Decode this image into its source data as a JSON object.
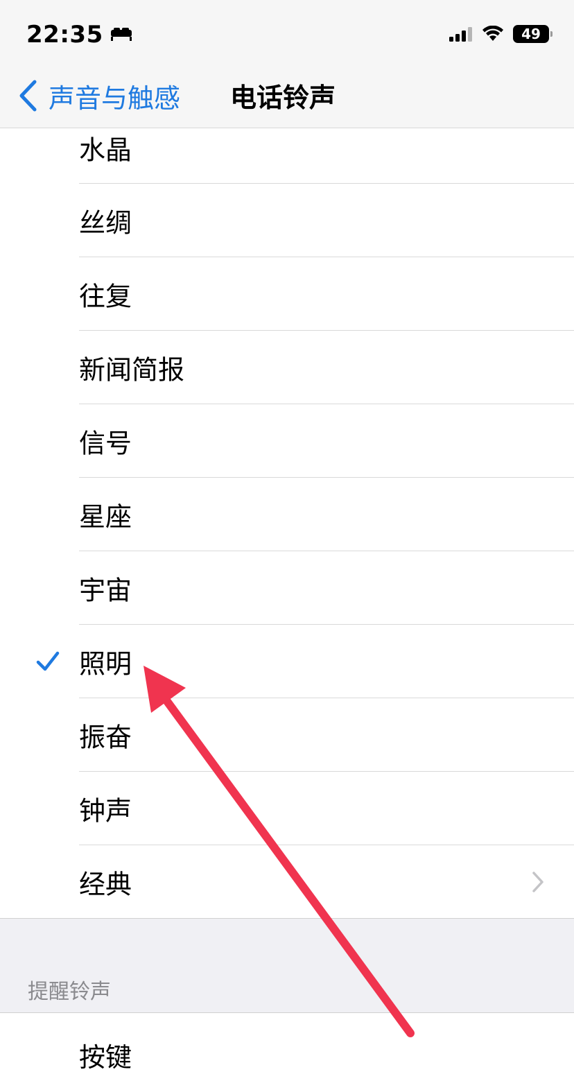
{
  "status_bar": {
    "time": "22:35",
    "battery": "49"
  },
  "nav": {
    "back_label": "声音与触感",
    "title": "电话铃声"
  },
  "ringtones": [
    {
      "label": "水晶"
    },
    {
      "label": "丝绸"
    },
    {
      "label": "往复"
    },
    {
      "label": "新闻简报"
    },
    {
      "label": "信号"
    },
    {
      "label": "星座"
    },
    {
      "label": "宇宙"
    },
    {
      "label": "照明",
      "selected": true
    },
    {
      "label": "振奋"
    },
    {
      "label": "钟声"
    },
    {
      "label": "经典",
      "has_chevron": true
    }
  ],
  "alert_section": {
    "header": "提醒铃声",
    "items": [
      {
        "label": "按键"
      }
    ]
  },
  "colors": {
    "accent": "#1f7ae0",
    "annotation_arrow": "#f0344f"
  },
  "icons": [
    "bed-icon",
    "cellular-signal-icon",
    "wifi-icon",
    "battery-icon",
    "chevron-left-icon",
    "checkmark-icon",
    "chevron-right-icon",
    "red-arrow-annotation"
  ]
}
